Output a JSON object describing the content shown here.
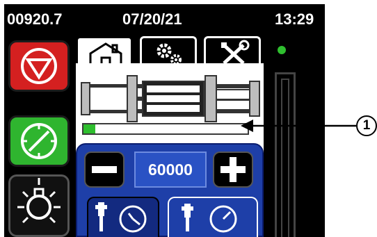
{
  "status_bar": {
    "counter": "00920.7",
    "date": "07/20/21",
    "time": "13:29"
  },
  "tabs": [
    {
      "icon": "home-icon",
      "active": true
    },
    {
      "icon": "gears-icon",
      "active": false
    },
    {
      "icon": "tools-icon",
      "active": false
    }
  ],
  "side_buttons": [
    {
      "icon": "stop-icon",
      "color": "#d42020"
    },
    {
      "icon": "timer-icon",
      "color": "#2fb52f"
    },
    {
      "icon": "light-icon",
      "color": "#111111"
    }
  ],
  "progress": {
    "value": 0.07,
    "color": "#2fbf2f"
  },
  "stepper": {
    "value": "60000"
  },
  "mode_buttons": [
    {
      "icon": "tool-timer-icon",
      "active": false
    },
    {
      "icon": "tool-timer-icon",
      "active": true
    }
  ],
  "gauge": {
    "indicator_color": "#2fbf2f"
  },
  "callout": {
    "label": "1"
  },
  "colors": {
    "panel_blue": "#1e3fa8",
    "value_blue": "#2a52c4",
    "background": "#000000"
  }
}
